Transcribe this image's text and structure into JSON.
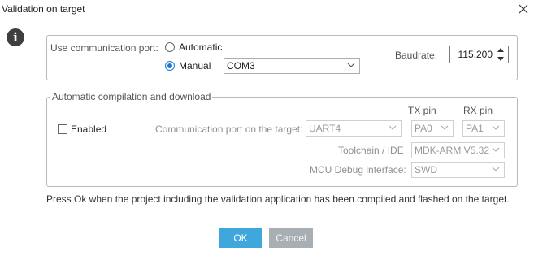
{
  "window": {
    "title": "Validation on target",
    "close_icon": "close-icon",
    "info_icon": "info-icon"
  },
  "port_section": {
    "label": "Use communication port:",
    "automatic_label": "Automatic",
    "manual_label": "Manual",
    "selected_mode": "Manual",
    "port_value": "COM3",
    "baudrate_label": "Baudrate:",
    "baudrate_value": "115,200"
  },
  "compile_section": {
    "legend": "Automatic compilation and download",
    "enabled_label": "Enabled",
    "enabled_checked": false,
    "tx_header": "TX pin",
    "rx_header": "RX pin",
    "comm_port_label": "Communication port on the target:",
    "comm_port_value": "UART4",
    "tx_value": "PA0",
    "rx_value": "PA1",
    "toolchain_label": "Toolchain / IDE",
    "toolchain_value": "MDK-ARM V5.32",
    "debug_label": "MCU Debug interface:",
    "debug_value": "SWD"
  },
  "message": "Press Ok when the project including the validation application has been compiled and flashed on the target.",
  "buttons": {
    "ok_label": "OK",
    "cancel_label": "Cancel"
  },
  "colors": {
    "accent": "#1e78d2",
    "ok_button": "#3fa7db",
    "cancel_button": "#a8aeb2"
  }
}
